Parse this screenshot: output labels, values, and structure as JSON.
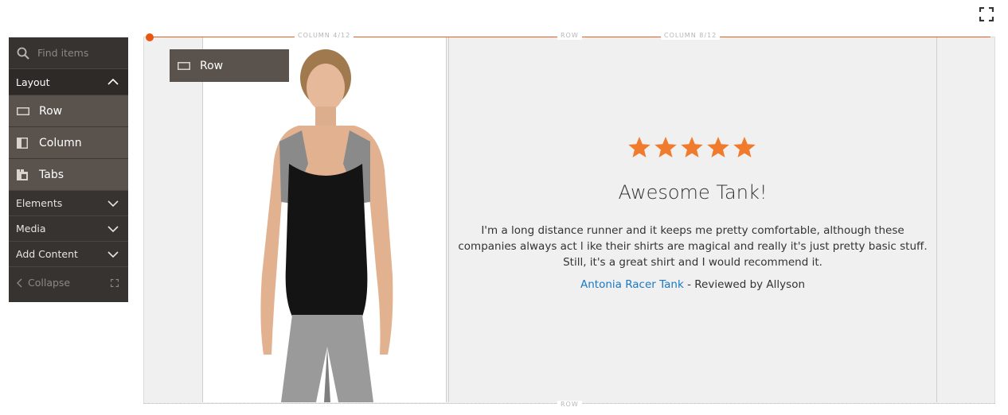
{
  "sidebar": {
    "search_placeholder": "Find items",
    "layout_group": "Layout",
    "items": [
      {
        "label": "Row",
        "icon": "row-icon"
      },
      {
        "label": "Column",
        "icon": "column-icon"
      },
      {
        "label": "Tabs",
        "icon": "tabs-icon"
      }
    ],
    "groups": [
      {
        "label": "Elements"
      },
      {
        "label": "Media"
      },
      {
        "label": "Add Content"
      }
    ],
    "collapse_label": "Collapse"
  },
  "stage": {
    "top_row_label": "ROW",
    "left_column_label": "COLUMN 4/12",
    "right_column_label": "COLUMN 8/12",
    "bottom_row_label": "ROW",
    "row_tooltip_label": "Row"
  },
  "review": {
    "rating_stars": 5,
    "star_color": "#f07b2d",
    "title": "Awesome Tank!",
    "body": "I'm a long distance runner and it keeps me pretty comfortable, although these companies always act l ike their shirts are magical and really it's just pretty basic stuff.  Still, it's a great shirt and I would recommend it.",
    "product_link": "Antonia Racer Tank",
    "reviewed_by": " - Reviewed by Allyson"
  },
  "colors": {
    "panel_bg": "#373330",
    "panel_item_bg": "#5a524c",
    "accent_orange": "#e8560f",
    "link_blue": "#1979c3"
  }
}
